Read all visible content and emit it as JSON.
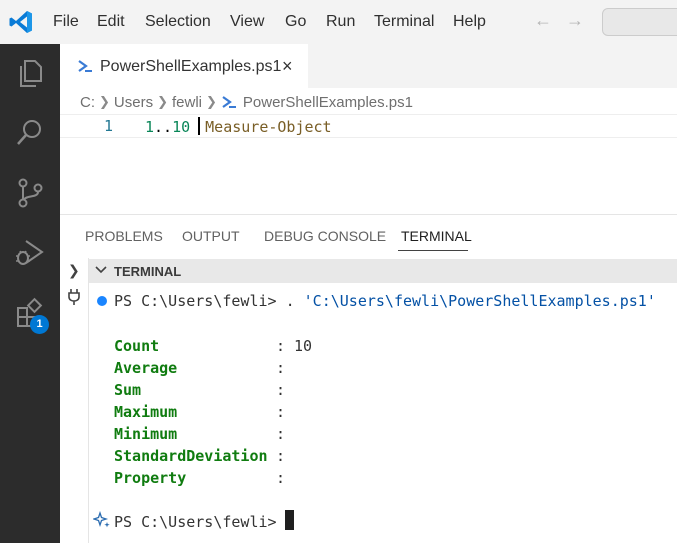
{
  "colors": {
    "accent": "#0078d4",
    "activitybar": "#2c2c2c",
    "terminal_green": "#107c10",
    "string_blue": "#0451a5"
  },
  "menu": [
    "File",
    "Edit",
    "Selection",
    "View",
    "Go",
    "Run",
    "Terminal",
    "Help"
  ],
  "activity": {
    "badge": "1",
    "icons": [
      "files-icon",
      "search-icon",
      "source-control-icon",
      "run-debug-icon",
      "extensions-icon"
    ]
  },
  "tab": {
    "label": "PowerShellExamples.ps1",
    "close": "×"
  },
  "breadcrumb": [
    "C:",
    "Users",
    "fewli",
    "PowerShellExamples.ps1"
  ],
  "editor": {
    "line_number": "1",
    "code_start": "1",
    "code_range_op": "..",
    "code_end": "10",
    "code_cmd": "Measure-Object"
  },
  "panel": {
    "tabs": [
      "PROBLEMS",
      "OUTPUT",
      "DEBUG CONSOLE",
      "TERMINAL"
    ],
    "active_tab": "TERMINAL"
  },
  "terminal": {
    "title": "TERMINAL",
    "command_prompt": "PS C:\\Users\\fewli> ",
    "command_text": ". ",
    "command_arg": "'C:\\Users\\fewli\\PowerShellExamples.ps1'",
    "output": [
      {
        "key": "Count",
        "value": "10"
      },
      {
        "key": "Average",
        "value": ""
      },
      {
        "key": "Sum",
        "value": ""
      },
      {
        "key": "Maximum",
        "value": ""
      },
      {
        "key": "Minimum",
        "value": ""
      },
      {
        "key": "StandardDeviation",
        "value": ""
      },
      {
        "key": "Property",
        "value": ""
      }
    ],
    "colon": ":",
    "final_prompt": "PS C:\\Users\\fewli>"
  }
}
